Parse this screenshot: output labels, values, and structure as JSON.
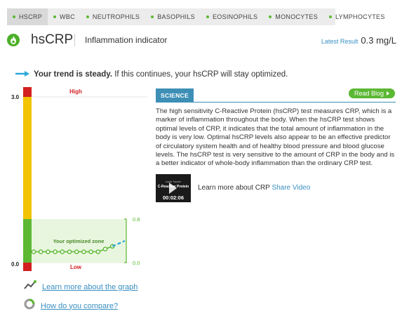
{
  "tabs": [
    {
      "label": "HSCRP",
      "active": true
    },
    {
      "label": "WBC",
      "active": false
    },
    {
      "label": "NEUTROPHILS",
      "active": false
    },
    {
      "label": "BASOPHILS",
      "active": false
    },
    {
      "label": "EOSINOPHILS",
      "active": false
    },
    {
      "label": "MONOCYTES",
      "active": false
    },
    {
      "label": "LYMPHOCYTES",
      "active": false
    }
  ],
  "header": {
    "icon": "flame-icon",
    "title": "hsCRP",
    "subtitle": "Inflammation indicator",
    "latest_label": "Latest Result",
    "latest_value": "0.3 mg/L"
  },
  "trend": {
    "bold": "Your trend is steady.",
    "rest": " If this continues, your hsCRP will stay optimized."
  },
  "chart": {
    "high_label": "High",
    "low_label": "Low",
    "y_top_label": "3.0",
    "y_bottom_label": "0.0",
    "zone_label": "Your optimized zone",
    "zone_top_label": "0.8",
    "zone_bottom_label": "0.0"
  },
  "chart_data": {
    "type": "line",
    "ylim": [
      0,
      3.0
    ],
    "optimized_zone": [
      0,
      0.8
    ],
    "series": [
      {
        "values": [
          0.2,
          0.2,
          0.2,
          0.2,
          0.2,
          0.2,
          0.2,
          0.2,
          0.2,
          0.2,
          0.25,
          0.3
        ]
      }
    ],
    "projected": [
      0.3,
      0.4
    ],
    "colors": {
      "high": "#d21f1f",
      "mid": "#f3c300",
      "optimal": "#5cb833",
      "projection": "#2aa8d8"
    }
  },
  "links": {
    "graph": "Learn more about the graph",
    "compare": "How do you compare?"
  },
  "science": {
    "tab_label": "SCIENCE",
    "read_blog": "Read Blog",
    "description": "The high sensitivity C-Reactive Protein (hsCRP) test measures CRP, which is a marker of inflammation throughout the body. When the hsCRP test shows optimal levels of CRP, it indicates that the total amount of inflammation in the body is very low. Optimal hsCRP levels also appear to be an effective predictor of circulatory system health and of healthy blood pressure and blood glucose levels. The hsCRP test is very sensitive to the amount of CRP in the body and is a better indicator of whole-body inflammation than the ordinary CRP test."
  },
  "video": {
    "small_text": "Inside Tracker",
    "title": "C-Reactive Protein",
    "duration": "00:02:06",
    "learn_text": "Learn more about CRP",
    "share_text": "Share Video"
  }
}
